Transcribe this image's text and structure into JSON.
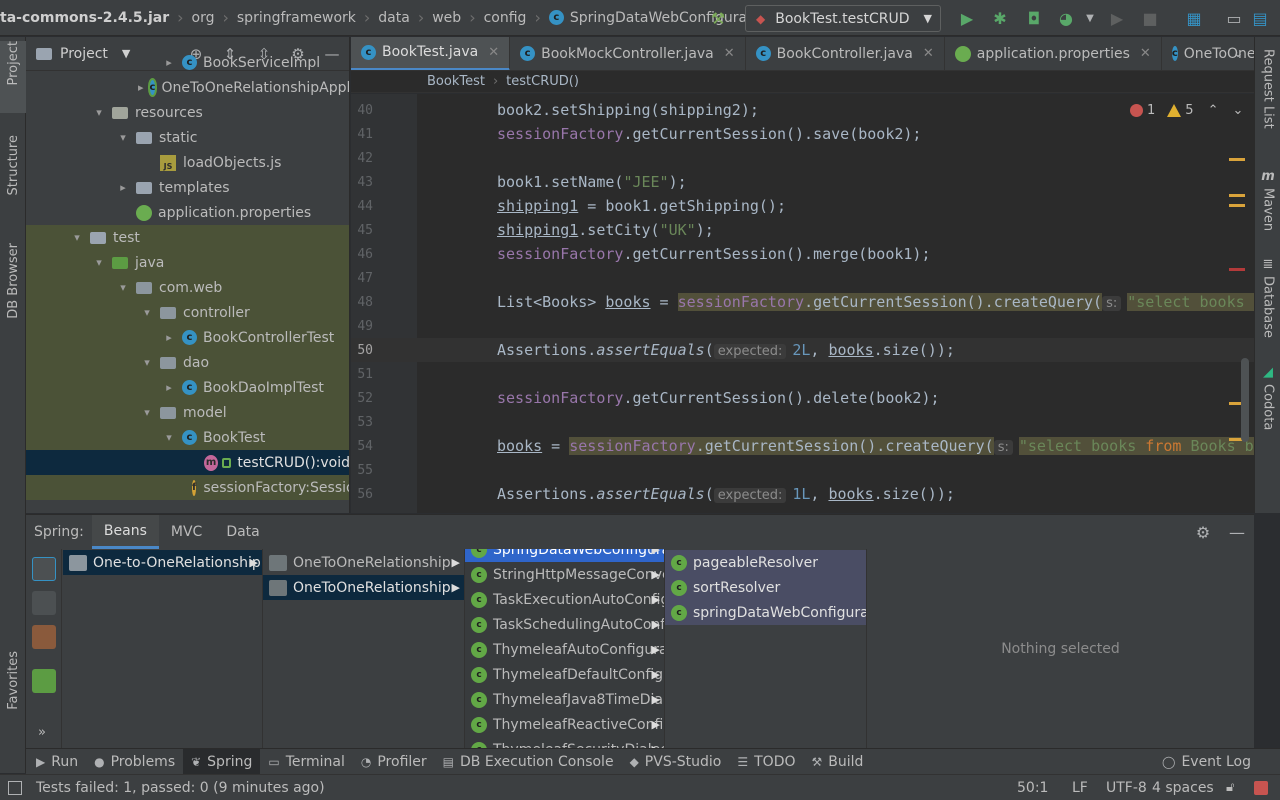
{
  "nav": {
    "breadcrumbs": [
      "ta-commons-2.4.5.jar",
      "org",
      "springframework",
      "data",
      "web",
      "config",
      "SpringDataWebConfiguration"
    ],
    "run_config": "BookTest.testCRUD"
  },
  "left_strip": [
    "Project",
    "Structure",
    "DB Browser",
    "Favorites"
  ],
  "right_strip": [
    "Request List",
    "Maven",
    "Database",
    "Codota"
  ],
  "project": {
    "title": "Project",
    "tree": [
      {
        "label": "BookServiceImpl",
        "indent": 136,
        "icon": "class",
        "arrow": "▸"
      },
      {
        "label": "OneToOneRelationshipApplication",
        "indent": 112,
        "icon": "spring-class",
        "arrow": "▸"
      },
      {
        "label": "resources",
        "indent": 66,
        "icon": "res-folder",
        "arrow": "▾"
      },
      {
        "label": "static",
        "indent": 90,
        "icon": "folder",
        "arrow": "▾"
      },
      {
        "label": "loadObjects.js",
        "indent": 114,
        "icon": "js",
        "arrow": ""
      },
      {
        "label": "templates",
        "indent": 90,
        "icon": "folder",
        "arrow": "▸"
      },
      {
        "label": "application.properties",
        "indent": 90,
        "icon": "spring-leaf",
        "arrow": ""
      },
      {
        "label": "test",
        "indent": 44,
        "icon": "folder",
        "arrow": "▾"
      },
      {
        "label": "java",
        "indent": 66,
        "icon": "green-folder",
        "arrow": "▾"
      },
      {
        "label": "com.web",
        "indent": 90,
        "icon": "package",
        "arrow": "▾"
      },
      {
        "label": "controller",
        "indent": 114,
        "icon": "package",
        "arrow": "▾"
      },
      {
        "label": "BookControllerTest",
        "indent": 136,
        "icon": "class",
        "arrow": "▸"
      },
      {
        "label": "dao",
        "indent": 114,
        "icon": "package",
        "arrow": "▾"
      },
      {
        "label": "BookDaoImplTest",
        "indent": 136,
        "icon": "class",
        "arrow": "▸"
      },
      {
        "label": "model",
        "indent": 114,
        "icon": "package",
        "arrow": "▾"
      },
      {
        "label": "BookTest",
        "indent": 136,
        "icon": "class",
        "arrow": "▾"
      },
      {
        "label": "testCRUD():void",
        "indent": 160,
        "icon": "method",
        "arrow": ""
      },
      {
        "label": "sessionFactory:SessionFactory",
        "indent": 160,
        "icon": "field",
        "arrow": ""
      }
    ]
  },
  "tabs": [
    {
      "label": "BookTest.java",
      "active": true
    },
    {
      "label": "BookMockController.java",
      "active": false
    },
    {
      "label": "BookController.java",
      "active": false
    },
    {
      "label": "application.properties",
      "active": false
    },
    {
      "label": "OneToOneRelationshipApplication.java",
      "active": false
    }
  ],
  "editor": {
    "breadcrumb": [
      "BookTest",
      "testCRUD()"
    ],
    "errors": "1",
    "warnings": "5",
    "line_numbers": [
      "40",
      "41",
      "42",
      "43",
      "44",
      "45",
      "46",
      "47",
      "48",
      "49",
      "50",
      "51",
      "52",
      "53",
      "54",
      "55",
      "56"
    ],
    "current_line": "50"
  },
  "code": {
    "l40a": "book2.setShipping(shipping2);",
    "l41_field": "sessionFactory",
    "l41_rest": ".getCurrentSession().save(book2);",
    "l43_a": "book1.setName(",
    "l43_s": "\"JEE\"",
    "l43_b": ");",
    "l44_v": "shipping1",
    "l44_rest": " = book1.getShipping();",
    "l45_v": "shipping1",
    "l45_a": ".setCity(",
    "l45_s": "\"UK\"",
    "l45_b": ");",
    "l46_field": "sessionFactory",
    "l46_rest": ".getCurrentSession().merge(book1);",
    "l48_a": "List<Books> ",
    "l48_v": "books",
    "l48_b": " = ",
    "l48_field": "sessionFactory",
    "l48_c": ".getCurrentSession().createQuery(",
    "l48_hint": "s:",
    "l48_s": "\"select books from Books books\"",
    "l50_a": "Assertions.",
    "l50_m": "assertEquals",
    "l50_b": "(",
    "l50_hint": "expected:",
    "l50_n": "2L",
    "l50_c": ", ",
    "l50_v": "books",
    "l50_d": ".size());",
    "l52_field": "sessionFactory",
    "l52_rest": ".getCurrentSession().delete(book2);",
    "l54_v": "books",
    "l54_a": " = ",
    "l54_field": "sessionFactory",
    "l54_b": ".getCurrentSession().createQuery(",
    "l54_hint": "s:",
    "l54_s1": "\"select books ",
    "l54_kw": "from",
    "l54_s2": " Books books\"",
    "l56_a": "Assertions.",
    "l56_m": "assertEquals",
    "l56_b": "(",
    "l56_hint": "expected:",
    "l56_n": "1L",
    "l56_c": ", ",
    "l56_v": "books",
    "l56_d": ".size());"
  },
  "spring": {
    "label": "Spring:",
    "tabs": [
      "Beans",
      "MVC",
      "Data"
    ],
    "col1": [
      "One-to-OneRelationship"
    ],
    "col2": [
      "OneToOneRelationship",
      "OneToOneRelationship"
    ],
    "col3": [
      "SpringDataWebConfiguration",
      "StringHttpMessageConverterAutoConfiguration",
      "TaskExecutionAutoConfiguration",
      "TaskSchedulingAutoConfiguration",
      "ThymeleafAutoConfiguration",
      "ThymeleafDefaultConfiguration",
      "ThymeleafJava8TimeDialect",
      "ThymeleafReactiveConfiguration",
      "ThymeleafSecurityDialectConfiguration"
    ],
    "col4": [
      "pageableResolver",
      "sortResolver",
      "springDataWebConfiguration"
    ],
    "nothing": "Nothing selected"
  },
  "tooltabs": [
    {
      "label": "Run",
      "icon": "▶"
    },
    {
      "label": "Problems",
      "icon": "●"
    },
    {
      "label": "Spring",
      "icon": "❦",
      "active": true
    },
    {
      "label": "Terminal",
      "icon": "▭"
    },
    {
      "label": "Profiler",
      "icon": "◔"
    },
    {
      "label": "DB Execution Console",
      "icon": "▤"
    },
    {
      "label": "PVS-Studio",
      "icon": "◆"
    },
    {
      "label": "TODO",
      "icon": "☰"
    },
    {
      "label": "Build",
      "icon": "⚒"
    }
  ],
  "event_log": "Event Log",
  "status": {
    "message": "Tests failed: 1, passed: 0 (9 minutes ago)",
    "position": "50:1",
    "line_sep": "LF",
    "encoding": "UTF-8",
    "indent": "4 spaces"
  }
}
